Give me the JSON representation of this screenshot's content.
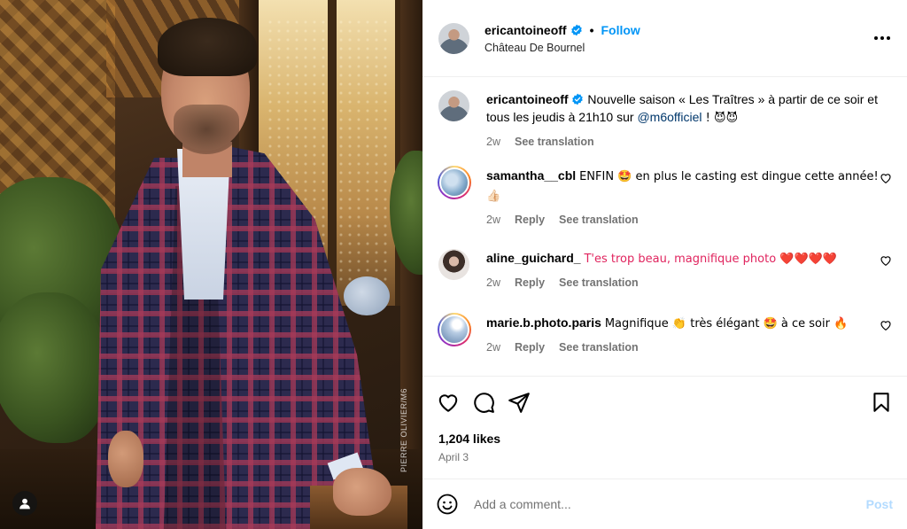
{
  "header": {
    "username": "ericantoineoff",
    "follow_label": "Follow",
    "location": "Château De Bournel"
  },
  "photo": {
    "watermark": "PIERRE OLIVIER/M6",
    "tag_icon": "person-icon"
  },
  "caption": {
    "username": "ericantoineoff",
    "text_before": "Nouvelle saison « Les Traîtres » à partir de ce soir et tous les jeudis à 21h10 sur ",
    "mention": "@m6officiel",
    "text_after": " ! 😈😈",
    "age": "2w",
    "see_translation": "See translation"
  },
  "comments": [
    {
      "username": "samantha__cbl",
      "text": "ENFIN 🤩 en plus le casting est dingue cette année! 👍🏻",
      "age": "2w",
      "reply": "Reply",
      "see_translation": "See translation",
      "avatar_color": "#7fa7c9"
    },
    {
      "username": "aline_guichard_",
      "text": "T'es trop beau, magnifique photo ❤️❤️❤️❤️",
      "age": "2w",
      "reply": "Reply",
      "see_translation": "See translation",
      "avatar_color": "#8b7d76"
    },
    {
      "username": "marie.b.photo.paris",
      "text": "Magnifique 👏 très élégant 🤩 à ce soir 🔥",
      "age": "2w",
      "reply": "Reply",
      "see_translation": "See translation",
      "avatar_color": "#9fb8d6"
    }
  ],
  "actions": {
    "likes": "1,204 likes",
    "date": "April 3"
  },
  "composer": {
    "placeholder": "Add a comment...",
    "post_label": "Post"
  },
  "colors": {
    "accent": "#0095f6",
    "muted": "#737373",
    "post_disabled": "#b3dbff"
  }
}
